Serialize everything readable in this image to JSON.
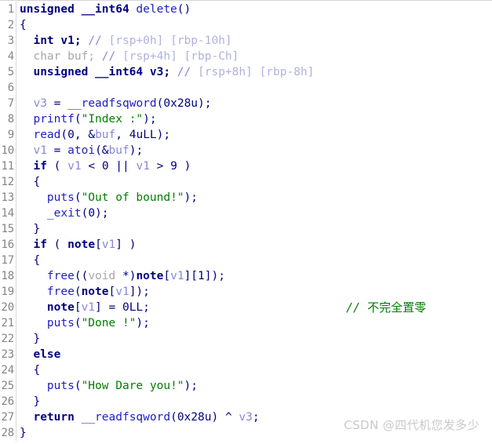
{
  "editor": {
    "title": "decompiled-code-view",
    "language": "c",
    "first_line_number": 1,
    "last_line_number": 28,
    "colors": {
      "background": "#ffffff",
      "gutter_text": "#848484",
      "gutter_rule": "#d9d9d9",
      "keyword": "#000080",
      "function": "#2020c0",
      "variable": "#8888d8",
      "string": "#008000",
      "comment_blue": "#8888d8",
      "comment_green": "#008000",
      "dimmed": "#a8a8a8",
      "watermark": "#c9c9c9"
    }
  },
  "lines": [
    {
      "n": "1",
      "tokens": [
        {
          "t": "kw",
          "v": "unsigned __int64 "
        },
        {
          "t": "fn",
          "v": "delete"
        },
        {
          "t": "punc",
          "v": "()"
        }
      ]
    },
    {
      "n": "2",
      "tokens": [
        {
          "t": "punc",
          "v": "{"
        }
      ]
    },
    {
      "n": "3",
      "tokens": [
        {
          "t": "plain",
          "v": "  "
        },
        {
          "t": "kw",
          "v": "int"
        },
        {
          "t": "kw",
          "v": " v1; "
        },
        {
          "t": "cmt",
          "v": "// "
        },
        {
          "t": "cmtx",
          "v": "[rsp+0h] [rbp-10h]"
        }
      ]
    },
    {
      "n": "4",
      "tokens": [
        {
          "t": "plain",
          "v": "  "
        },
        {
          "t": "gray",
          "v": "char buf; "
        },
        {
          "t": "cmt",
          "v": "// "
        },
        {
          "t": "cmtx",
          "v": "[rsp+4h] [rbp-Ch]"
        }
      ]
    },
    {
      "n": "5",
      "tokens": [
        {
          "t": "plain",
          "v": "  "
        },
        {
          "t": "kw",
          "v": "unsigned __int64 v3; "
        },
        {
          "t": "cmt",
          "v": "// "
        },
        {
          "t": "cmtx",
          "v": "[rsp+8h] [rbp-8h]"
        }
      ]
    },
    {
      "n": "6",
      "tokens": [
        {
          "t": "plain",
          "v": ""
        }
      ]
    },
    {
      "n": "7",
      "tokens": [
        {
          "t": "plain",
          "v": "  "
        },
        {
          "t": "var",
          "v": "v3"
        },
        {
          "t": "punc",
          "v": " = "
        },
        {
          "t": "fn",
          "v": "__readfsqword"
        },
        {
          "t": "punc",
          "v": "("
        },
        {
          "t": "num",
          "v": "0x28u"
        },
        {
          "t": "punc",
          "v": ");"
        }
      ]
    },
    {
      "n": "8",
      "tokens": [
        {
          "t": "plain",
          "v": "  "
        },
        {
          "t": "fn",
          "v": "printf"
        },
        {
          "t": "punc",
          "v": "("
        },
        {
          "t": "str",
          "v": "\"Index :\""
        },
        {
          "t": "punc",
          "v": ");"
        }
      ]
    },
    {
      "n": "9",
      "tokens": [
        {
          "t": "plain",
          "v": "  "
        },
        {
          "t": "fn",
          "v": "read"
        },
        {
          "t": "punc",
          "v": "("
        },
        {
          "t": "num",
          "v": "0"
        },
        {
          "t": "punc",
          "v": ", &"
        },
        {
          "t": "var",
          "v": "buf"
        },
        {
          "t": "punc",
          "v": ", "
        },
        {
          "t": "num",
          "v": "4uLL"
        },
        {
          "t": "punc",
          "v": ");"
        }
      ]
    },
    {
      "n": "10",
      "tokens": [
        {
          "t": "plain",
          "v": "  "
        },
        {
          "t": "var",
          "v": "v1"
        },
        {
          "t": "punc",
          "v": " = "
        },
        {
          "t": "fn",
          "v": "atoi"
        },
        {
          "t": "punc",
          "v": "(&"
        },
        {
          "t": "var",
          "v": "buf"
        },
        {
          "t": "punc",
          "v": ");"
        }
      ]
    },
    {
      "n": "11",
      "tokens": [
        {
          "t": "plain",
          "v": "  "
        },
        {
          "t": "kw",
          "v": "if"
        },
        {
          "t": "punc",
          "v": " ( "
        },
        {
          "t": "var",
          "v": "v1"
        },
        {
          "t": "punc",
          "v": " < "
        },
        {
          "t": "num",
          "v": "0"
        },
        {
          "t": "punc",
          "v": " || "
        },
        {
          "t": "var",
          "v": "v1"
        },
        {
          "t": "punc",
          "v": " > "
        },
        {
          "t": "num",
          "v": "9"
        },
        {
          "t": "punc",
          "v": " )"
        }
      ]
    },
    {
      "n": "12",
      "tokens": [
        {
          "t": "plain",
          "v": "  "
        },
        {
          "t": "punc",
          "v": "{"
        }
      ]
    },
    {
      "n": "13",
      "tokens": [
        {
          "t": "plain",
          "v": "    "
        },
        {
          "t": "fn",
          "v": "puts"
        },
        {
          "t": "punc",
          "v": "("
        },
        {
          "t": "str",
          "v": "\"Out of bound!\""
        },
        {
          "t": "punc",
          "v": ");"
        }
      ]
    },
    {
      "n": "14",
      "tokens": [
        {
          "t": "plain",
          "v": "    "
        },
        {
          "t": "fn",
          "v": "_exit"
        },
        {
          "t": "punc",
          "v": "("
        },
        {
          "t": "num",
          "v": "0"
        },
        {
          "t": "punc",
          "v": ");"
        }
      ]
    },
    {
      "n": "15",
      "tokens": [
        {
          "t": "plain",
          "v": "  "
        },
        {
          "t": "punc",
          "v": "}"
        }
      ]
    },
    {
      "n": "16",
      "tokens": [
        {
          "t": "plain",
          "v": "  "
        },
        {
          "t": "kw",
          "v": "if"
        },
        {
          "t": "punc",
          "v": " ( "
        },
        {
          "t": "sym",
          "v": "note"
        },
        {
          "t": "punc",
          "v": "["
        },
        {
          "t": "var",
          "v": "v1"
        },
        {
          "t": "punc",
          "v": "] )"
        }
      ]
    },
    {
      "n": "17",
      "tokens": [
        {
          "t": "plain",
          "v": "  "
        },
        {
          "t": "punc",
          "v": "{"
        }
      ]
    },
    {
      "n": "18",
      "tokens": [
        {
          "t": "plain",
          "v": "    "
        },
        {
          "t": "fn",
          "v": "free"
        },
        {
          "t": "punc",
          "v": "(("
        },
        {
          "t": "gray",
          "v": "void"
        },
        {
          "t": "punc",
          "v": " *)"
        },
        {
          "t": "sym",
          "v": "note"
        },
        {
          "t": "punc",
          "v": "["
        },
        {
          "t": "var",
          "v": "v1"
        },
        {
          "t": "punc",
          "v": "]["
        },
        {
          "t": "num",
          "v": "1"
        },
        {
          "t": "punc",
          "v": "]);"
        }
      ]
    },
    {
      "n": "19",
      "tokens": [
        {
          "t": "plain",
          "v": "    "
        },
        {
          "t": "fn",
          "v": "free"
        },
        {
          "t": "punc",
          "v": "("
        },
        {
          "t": "sym",
          "v": "note"
        },
        {
          "t": "punc",
          "v": "["
        },
        {
          "t": "var",
          "v": "v1"
        },
        {
          "t": "punc",
          "v": "]);"
        }
      ]
    },
    {
      "n": "20",
      "tokens": [
        {
          "t": "plain",
          "v": "    "
        },
        {
          "t": "sym",
          "v": "note"
        },
        {
          "t": "punc",
          "v": "["
        },
        {
          "t": "var",
          "v": "v1"
        },
        {
          "t": "punc",
          "v": "] = "
        },
        {
          "t": "num",
          "v": "0LL"
        },
        {
          "t": "punc",
          "v": ";"
        }
      ],
      "side_comment": {
        "slashes": "// ",
        "text": "不完全置零"
      }
    },
    {
      "n": "21",
      "tokens": [
        {
          "t": "plain",
          "v": "    "
        },
        {
          "t": "fn",
          "v": "puts"
        },
        {
          "t": "punc",
          "v": "("
        },
        {
          "t": "str",
          "v": "\"Done !\""
        },
        {
          "t": "punc",
          "v": ");"
        }
      ]
    },
    {
      "n": "22",
      "tokens": [
        {
          "t": "plain",
          "v": "  "
        },
        {
          "t": "punc",
          "v": "}"
        }
      ]
    },
    {
      "n": "23",
      "tokens": [
        {
          "t": "plain",
          "v": "  "
        },
        {
          "t": "kw",
          "v": "else"
        }
      ]
    },
    {
      "n": "24",
      "tokens": [
        {
          "t": "plain",
          "v": "  "
        },
        {
          "t": "punc",
          "v": "{"
        }
      ]
    },
    {
      "n": "25",
      "tokens": [
        {
          "t": "plain",
          "v": "    "
        },
        {
          "t": "fn",
          "v": "puts"
        },
        {
          "t": "punc",
          "v": "("
        },
        {
          "t": "str",
          "v": "\"How Dare you!\""
        },
        {
          "t": "punc",
          "v": ");"
        }
      ]
    },
    {
      "n": "26",
      "tokens": [
        {
          "t": "plain",
          "v": "  "
        },
        {
          "t": "punc",
          "v": "}"
        }
      ]
    },
    {
      "n": "27",
      "tokens": [
        {
          "t": "plain",
          "v": "  "
        },
        {
          "t": "kw",
          "v": "return"
        },
        {
          "t": "punc",
          "v": " "
        },
        {
          "t": "fn",
          "v": "__readfsqword"
        },
        {
          "t": "punc",
          "v": "("
        },
        {
          "t": "num",
          "v": "0x28u"
        },
        {
          "t": "punc",
          "v": ") ^ "
        },
        {
          "t": "var",
          "v": "v3"
        },
        {
          "t": "punc",
          "v": ";"
        }
      ]
    },
    {
      "n": "28",
      "tokens": [
        {
          "t": "punc",
          "v": "}"
        }
      ]
    }
  ],
  "watermark": {
    "text": "CSDN @四代机您发多少"
  }
}
